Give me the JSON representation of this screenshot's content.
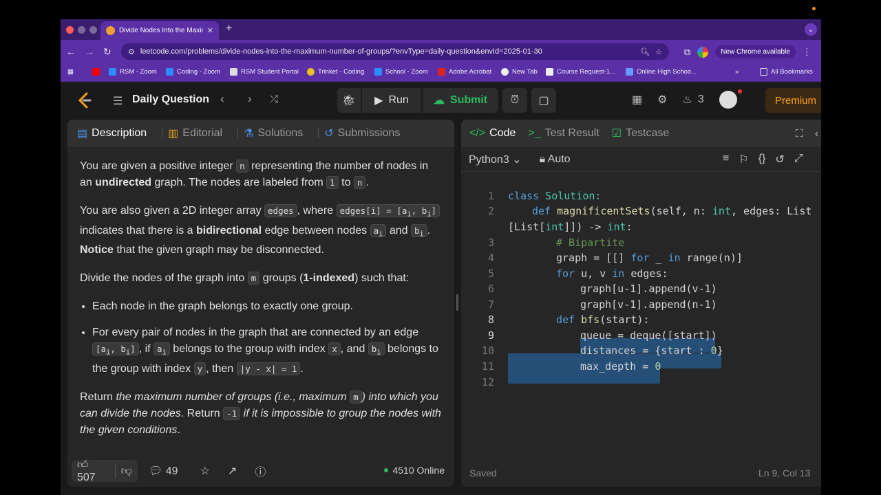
{
  "browser": {
    "tab_title": "Divide Nodes Into the Maximum Number of Groups",
    "url": "leetcode.com/problems/divide-nodes-into-the-maximum-number-of-groups/?envType=daily-question&envId=2025-01-30",
    "new_chrome_label": "New Chrome available",
    "bookmarks": [
      "RSM - Zoom",
      "Coding - Zoom",
      "RSM Student Portal",
      "Trinket - Coding",
      "School - Zoom",
      "Adobe Acrobat",
      "New Tab",
      "Course Request-1...",
      "Online High Schoo..."
    ],
    "all_bookmarks_label": "All Bookmarks"
  },
  "nav": {
    "title": "Daily Question",
    "run_label": "Run",
    "submit_label": "Submit",
    "streak": "3",
    "premium_label": "Premium"
  },
  "left": {
    "tabs": [
      "Description",
      "Editorial",
      "Solutions",
      "Submissions"
    ],
    "likes": "507",
    "comments": "49",
    "online": "4510 Online"
  },
  "description": {
    "p1_a": "You are given a positive integer ",
    "p1_n": "n",
    "p1_b": " representing the number of nodes in an ",
    "p1_bold": "undirected",
    "p1_c": " graph. The nodes are labeled from ",
    "p1_one": "1",
    "p1_to": " to ",
    "p1_n2": "n",
    "p1_end": ".",
    "p2_a": "You are also given a 2D integer array ",
    "p2_edges": "edges",
    "p2_b": ", where ",
    "p2_edgesi": "edges[i] = [a",
    "p2_sub_i": "i",
    "p2_comma": ", b",
    "p2_close": "]",
    "p2_c": " indicates that there is a ",
    "p2_bold": "bidirectional",
    "p2_d": " edge between nodes ",
    "p2_a_var": "a",
    "p2_and": " and ",
    "p2_b_var": "b",
    "p2_dot": ". ",
    "p2_notice": "Notice",
    "p2_e": " that the given graph may be disconnected.",
    "p3_a": "Divide the nodes of the graph into ",
    "p3_m": "m",
    "p3_b": " groups (",
    "p3_bold": "1-indexed",
    "p3_c": ") such that:",
    "li1": "Each node in the graph belongs to exactly one group.",
    "li2_a": "For every pair of nodes in the graph that are connected by an edge ",
    "li2_pair_a": "[a",
    "li2_pair_b": ", b",
    "li2_pair_c": "]",
    "li2_b": ", if ",
    "li2_ai": "a",
    "li2_c": " belongs to the group with index ",
    "li2_x": "x",
    "li2_d": ", and ",
    "li2_bi": "b",
    "li2_e": " belongs to the group with index ",
    "li2_y": "y",
    "li2_f": ", then ",
    "li2_abs": "|y - x| = 1",
    "li2_end": ".",
    "p4_a": "Return ",
    "p4_it1": "the maximum number of groups (i.e., maximum ",
    "p4_m": "m",
    "p4_it2": ") into which you can divide the nodes",
    "p4_b": ". Return ",
    "p4_neg": "-1",
    "p4_it3": " if it is impossible to group the nodes with the given conditions",
    "p4_end": "."
  },
  "right": {
    "tabs": [
      "Code",
      "Test Result",
      "Testcase"
    ],
    "language": "Python3",
    "mode": "Auto",
    "status": "Saved",
    "cursor": "Ln 9, Col 13"
  },
  "code_lines": [
    "1",
    "2",
    "3",
    "4",
    "5",
    "6",
    "7",
    "8",
    "9",
    "10",
    "11",
    "12"
  ],
  "code": {
    "l1_kw": "class",
    "l1_rest": " Solution:",
    "l2_kw": "def",
    "l2_fn": "magnificentSets",
    "l2_a": "(self, n: ",
    "l2_int": "int",
    "l2_b": ", edges: List",
    "l2b_a": "[List[",
    "l2b_int": "int",
    "l2b_b": "]]) -> ",
    "l2b_int2": "int",
    "l2b_c": ":",
    "l3": "# Bipartite",
    "l4_a": "graph = [[] ",
    "l4_for": "for",
    "l4_b": " _ ",
    "l4_in": "in",
    "l4_c": " range(n)]",
    "l5_for": "for",
    "l5_a": " u, v ",
    "l5_in": "in",
    "l5_b": " edges:",
    "l6": "graph[u-1].append(v-1)",
    "l7": "graph[v-1].append(n-1)",
    "l8_kw": "def",
    "l8_fn": "bfs",
    "l8_rest": "(start):",
    "l9": "queue = deque([start])",
    "l10_a": "distances = {start : ",
    "l10_n": "0",
    "l10_b": "}",
    "l11_a": "max_depth = ",
    "l11_n": "0"
  }
}
